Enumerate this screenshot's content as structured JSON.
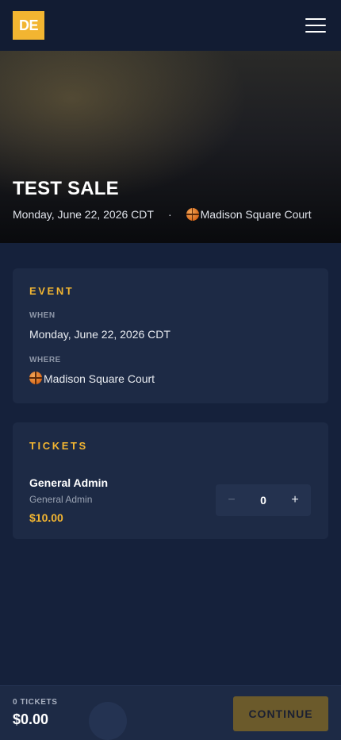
{
  "header": {
    "logo_text": "DE",
    "menu_icon": "hamburger-menu-icon"
  },
  "hero": {
    "title": "TEST SALE",
    "date": "Monday, June 22, 2026 CDT",
    "separator": "·",
    "venue": "Madison Square Court",
    "venue_icon": "basketball-icon"
  },
  "event": {
    "section_label": "EVENT",
    "when_label": "WHEN",
    "when_value": "Monday, June 22, 2026 CDT",
    "where_label": "WHERE",
    "where_value": "Madison Square Court"
  },
  "tickets": {
    "section_label": "TICKETS",
    "items": [
      {
        "name": "General Admin",
        "description": "General Admin",
        "price": "$10.00",
        "quantity": "0",
        "minus_symbol": "−",
        "plus_symbol": "+"
      }
    ]
  },
  "footer": {
    "count_label": "0 TICKETS",
    "total": "$0.00",
    "continue_label": "CONTINUE"
  },
  "colors": {
    "accent": "#f2b531",
    "background": "#15213b",
    "card": "#1d2a45",
    "continue_disabled": "#6b5a2b"
  }
}
